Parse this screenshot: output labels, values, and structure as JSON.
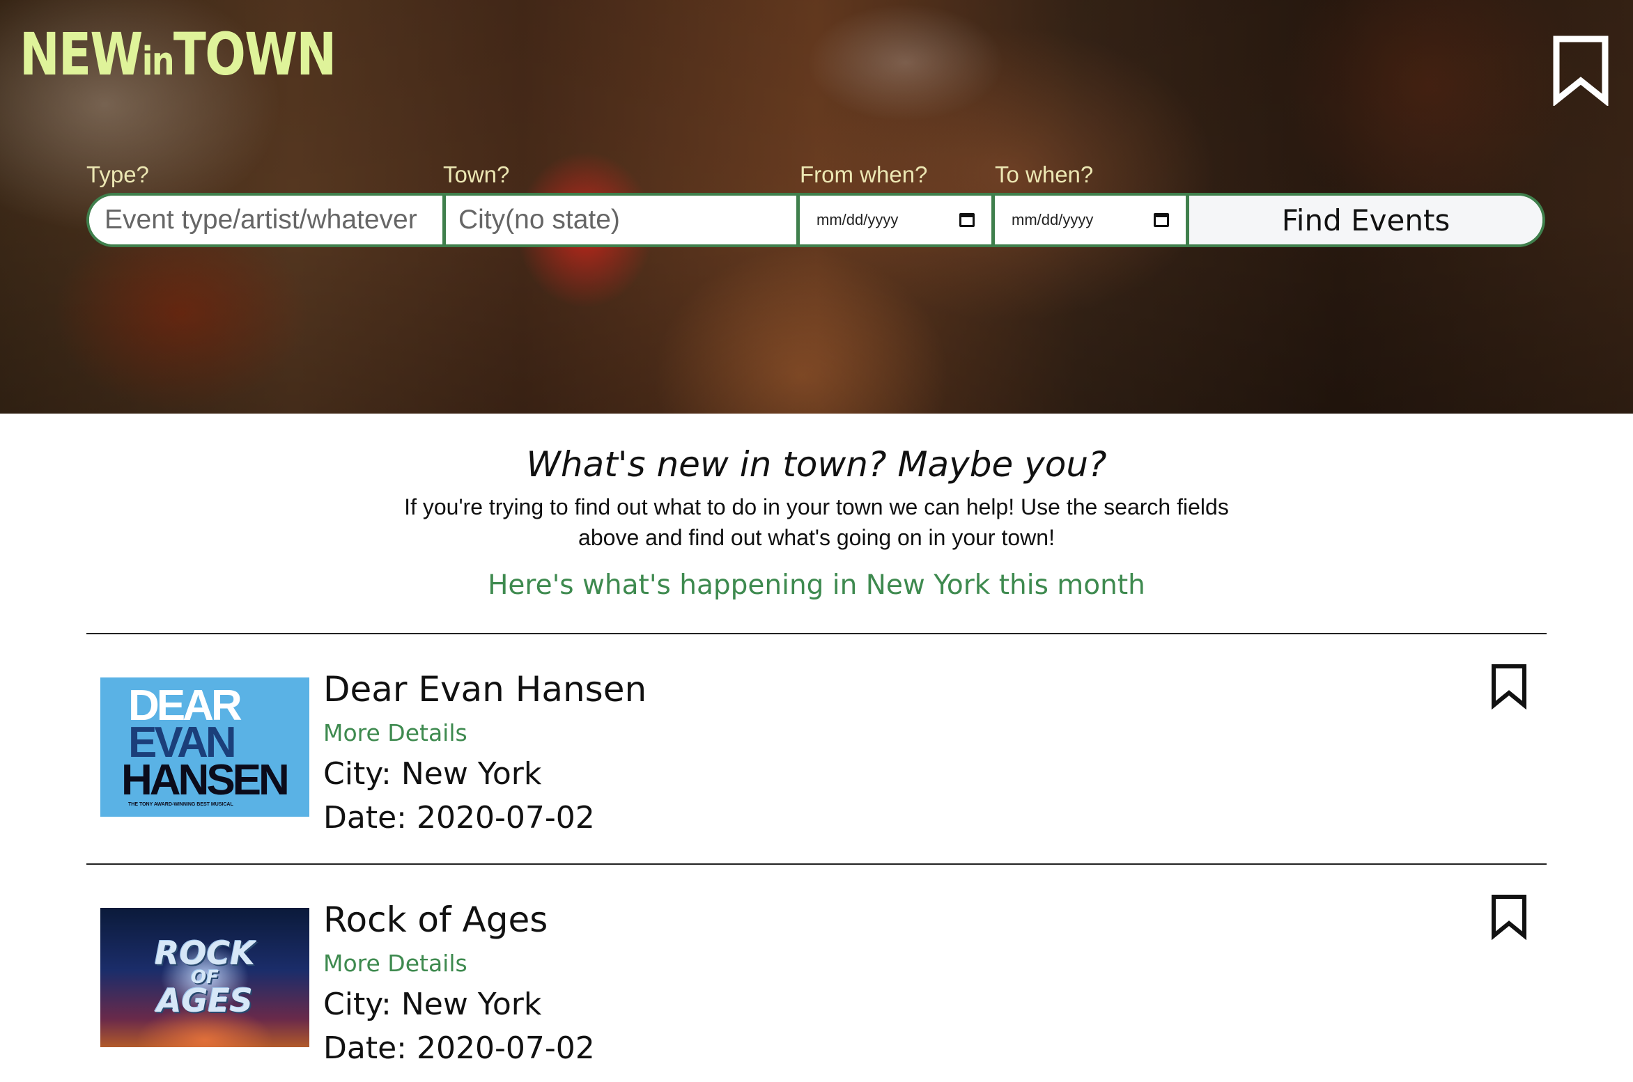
{
  "header": {
    "logo": {
      "part1": "NEW",
      "part2": "in",
      "part3": "TOWN"
    },
    "bookmark_icon": "bookmark-outline-icon"
  },
  "search": {
    "labels": {
      "type": "Type?",
      "town": "Town?",
      "from": "From when?",
      "to": "To when?"
    },
    "type_placeholder": "Event type/artist/whatever",
    "town_placeholder": "City(no state)",
    "from_value": "mm/dd/yyyy",
    "to_value": "mm/dd/yyyy",
    "find_button": "Find Events"
  },
  "intro": {
    "heading": "What's new in town? Maybe you?",
    "description": "If you're trying to find out what to do in your town we can help! Use the search fields above and find out what's going on in your town!",
    "happening": "Here's what's happening in New York this month"
  },
  "events": [
    {
      "title": "Dear Evan Hansen",
      "more_details": "More Details",
      "city": "City: New York",
      "date": "Date: 2020-07-02",
      "art": {
        "line1": "DEAR",
        "line2": "EVAN",
        "line3": "HANSEN",
        "tagline": "THE TONY AWARD-WINNING BEST MUSICAL"
      }
    },
    {
      "title": "Rock of Ages",
      "more_details": "More Details",
      "city": "City: New York",
      "date": "Date: 2020-07-02",
      "art": {
        "line1": "ROCK",
        "line2": "OF",
        "line3": "AGES"
      }
    }
  ],
  "colors": {
    "accent_green": "#3e8a4f",
    "border_green": "#3f7f4c",
    "logo_yellow": "#dff39a",
    "deh_blue": "#5ab2e5"
  }
}
